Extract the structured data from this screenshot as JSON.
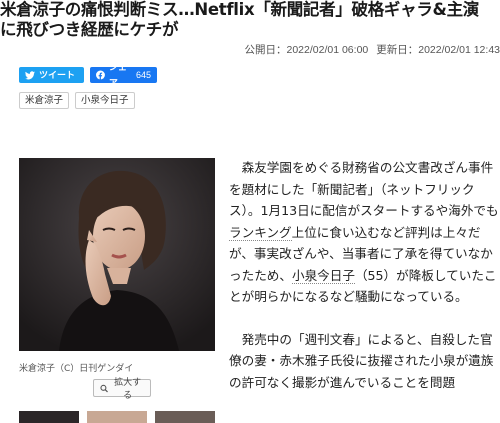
{
  "article": {
    "title_line1": "米倉涼子の痛恨判断ミス…Netflix「新聞記者」破格ギャラ&主演",
    "title_line2": "に飛びつき経歴にケチが",
    "published": "公開日：2022/02/01 06:00",
    "updated": "更新日：2022/02/01 12:43",
    "body": {
      "p1_part1": "森友学園をめぐる財務省の公文書改ざん事件を題材にした「新聞記者」（ネットフリックス）。1月13日に配信がスタートするや海外でも",
      "p1_link1": "ランキング",
      "p1_part2": "上位に食い込むなど評判は上々だが、事実改ざんや、当事者に了承を得ていなかったため、",
      "p1_link2": "小泉今日子",
      "p1_part3": "（55）が降板していたことが明らかになるなど騒動になっている。",
      "p2": "発売中の「週刊文春」によると、自殺した官僚の妻・赤木雅子氏役に抜擢された小泉が遺族の許可なく撮影が進んでいることを問題"
    }
  },
  "share": {
    "tweet_label": "ツイート",
    "facebook_label": "シェア",
    "facebook_count": "645",
    "twitter_color": "#1da1f2",
    "facebook_color": "#1877f2"
  },
  "tags": [
    "米倉涼子",
    "小泉今日子"
  ],
  "photo": {
    "caption": "米倉涼子（C）日刊ゲンダイ",
    "zoom_label": "拡大する"
  }
}
